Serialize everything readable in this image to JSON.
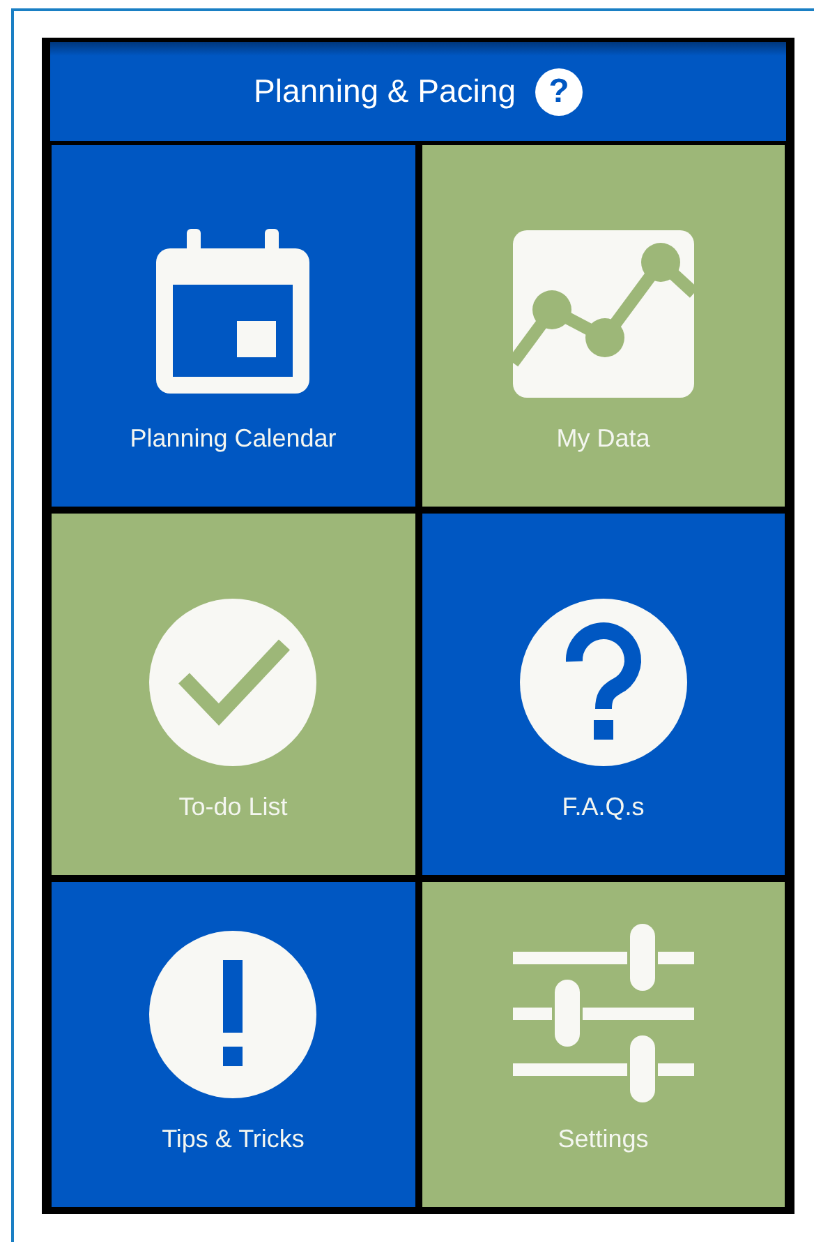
{
  "header": {
    "title": "Planning & Pacing",
    "help": "?"
  },
  "tiles": [
    {
      "label": "Planning Calendar",
      "color": "#0057c2"
    },
    {
      "label": "My Data",
      "color": "#9db778"
    },
    {
      "label": "To-do List",
      "color": "#9db778"
    },
    {
      "label": "F.A.Q.s",
      "color": "#0057c2"
    },
    {
      "label": "Tips & Tricks",
      "color": "#0057c2"
    },
    {
      "label": "Settings",
      "color": "#9db778"
    }
  ]
}
